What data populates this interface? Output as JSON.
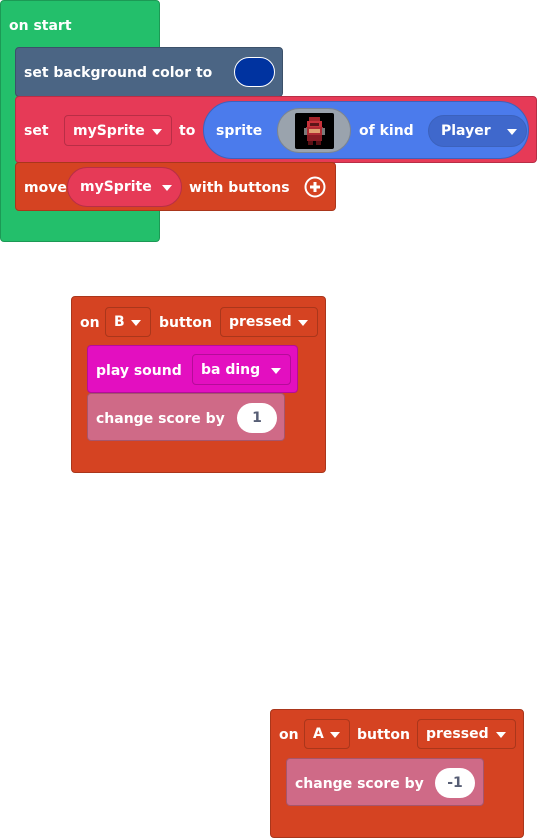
{
  "colors": {
    "loops_green": "#23bf6b",
    "scene_slate": "#4b6584",
    "variables_red": "#e63a57",
    "sprites_blue": "#4b7bec",
    "controller_orange": "#d54322",
    "music_magenta": "#e30fc0",
    "info_pink": "#cf6a87",
    "background_color_value": "#0033a0"
  },
  "on_start": {
    "label": "on start",
    "set_background": {
      "label": "set background color to",
      "color": "#0033a0"
    },
    "set_sprite": {
      "set_label": "set",
      "variable": "mySprite",
      "to_label": "to",
      "sprite_label": "sprite",
      "image_icon": "red-knight-sprite-icon",
      "of_kind_label": "of kind",
      "kind": "Player"
    },
    "move_sprite": {
      "move_label": "move",
      "variable": "mySprite",
      "with_buttons_label": "with buttons",
      "expand_icon": "plus-circle-icon"
    }
  },
  "on_b_pressed": {
    "on_label": "on",
    "button": "B",
    "button_label": "button",
    "event": "pressed",
    "play_sound": {
      "label": "play sound",
      "sound": "ba ding"
    },
    "change_score": {
      "label": "change score by",
      "value": "1"
    }
  },
  "on_a_pressed": {
    "on_label": "on",
    "button": "A",
    "button_label": "button",
    "event": "pressed",
    "change_score": {
      "label": "change score by",
      "value": "-1"
    }
  }
}
